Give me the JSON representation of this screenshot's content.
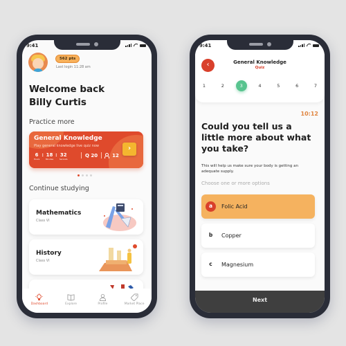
{
  "dashboard": {
    "status_time": "9:41",
    "points_badge": "562 pts",
    "last_login": "Last login 11:28 am",
    "welcome_line1": "Welcome back",
    "welcome_line2": "Billy Curtis",
    "practice_label": "Practice more",
    "quiz_card": {
      "title": "General Knowledge",
      "subtitle": "Play general knowledge live quiz now",
      "timer": [
        {
          "value": "6",
          "unit": "Hours"
        },
        {
          "value": "18",
          "unit": "Minutes"
        },
        {
          "value": "32",
          "unit": "Seconds"
        }
      ],
      "questions": "Q 20",
      "participants": "12",
      "go_icon": "chevron-right-icon",
      "colors": {
        "card": "#df4a2c",
        "button": "#f4b62f"
      }
    },
    "carousel": {
      "count": 4,
      "active_index": 0
    },
    "continue_label": "Continue studying",
    "subjects": [
      {
        "title": "Mathematics",
        "class": "Class VI",
        "illustration": "math-tools-illustration"
      },
      {
        "title": "History",
        "class": "Class VI",
        "illustration": "ruins-explorer-illustration"
      },
      {
        "title": "",
        "class": "",
        "illustration": "partial-card-illustration"
      }
    ],
    "tabs": [
      {
        "label": "Dashboard",
        "icon": "lightbulb-icon",
        "active": true
      },
      {
        "label": "Explore",
        "icon": "book-open-icon",
        "active": false
      },
      {
        "label": "Profile",
        "icon": "user-icon",
        "active": false
      },
      {
        "label": "Market Place",
        "icon": "tag-icon",
        "active": false
      }
    ]
  },
  "quiz": {
    "status_time": "9:41",
    "back_icon": "chevron-left-icon",
    "title": "General Knowledge",
    "subtitle": "Quiz",
    "steps": [
      "1",
      "2",
      "3",
      "4",
      "5",
      "6",
      "7"
    ],
    "active_step": 3,
    "timer": "10:12",
    "question": "Could you tell us a little more about what you take?",
    "help_text": "This will help us make sure your body is getting an adequate supply.",
    "hint": "Choose one or more options",
    "options": [
      {
        "letter": "a",
        "text": "Folic Acid",
        "selected": true
      },
      {
        "letter": "b",
        "text": "Copper",
        "selected": false
      },
      {
        "letter": "c",
        "text": "Magnesium",
        "selected": false
      }
    ],
    "next_label": "Next",
    "colors": {
      "accent": "#d9402b",
      "step_active": "#58c48f",
      "selected_option": "#f5b25f",
      "timer": "#e0843e"
    }
  }
}
